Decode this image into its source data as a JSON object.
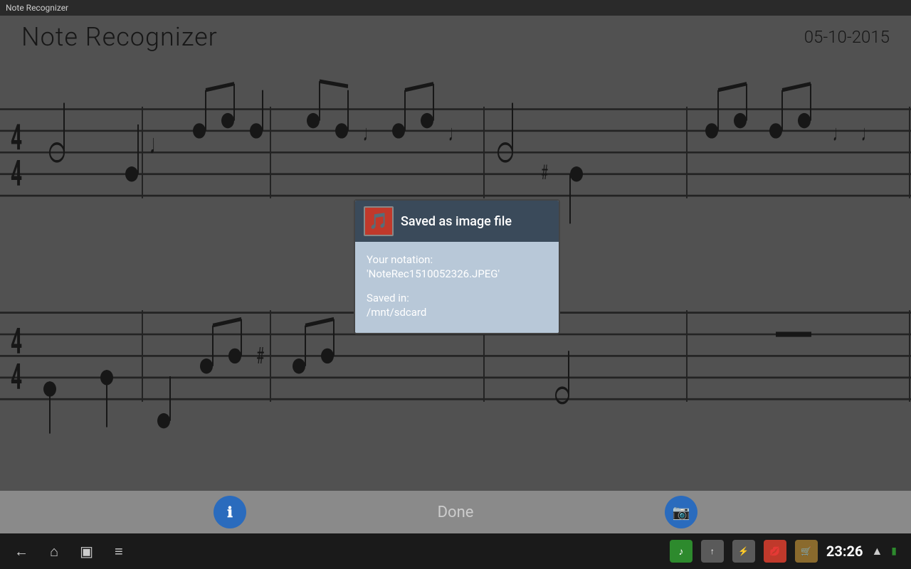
{
  "titlebar": {
    "text": "Note Recognizer"
  },
  "header": {
    "title": "Note Recognizer",
    "date": "05-10-2015"
  },
  "dialog": {
    "title": "Saved as image file",
    "icon_label": "♪",
    "notation_label": "Your notation:",
    "notation_value": "'NoteRec1510052326.JPEG'",
    "saved_label": "Saved in:",
    "saved_value": "/mnt/sdcard"
  },
  "action_bar": {
    "info_icon": "ℹ",
    "done_label": "Done",
    "camera_icon": "📷"
  },
  "navbar": {
    "back_icon": "←",
    "home_icon": "⌂",
    "recents_icon": "▣",
    "menu_icon": "≡",
    "time": "23:26"
  }
}
